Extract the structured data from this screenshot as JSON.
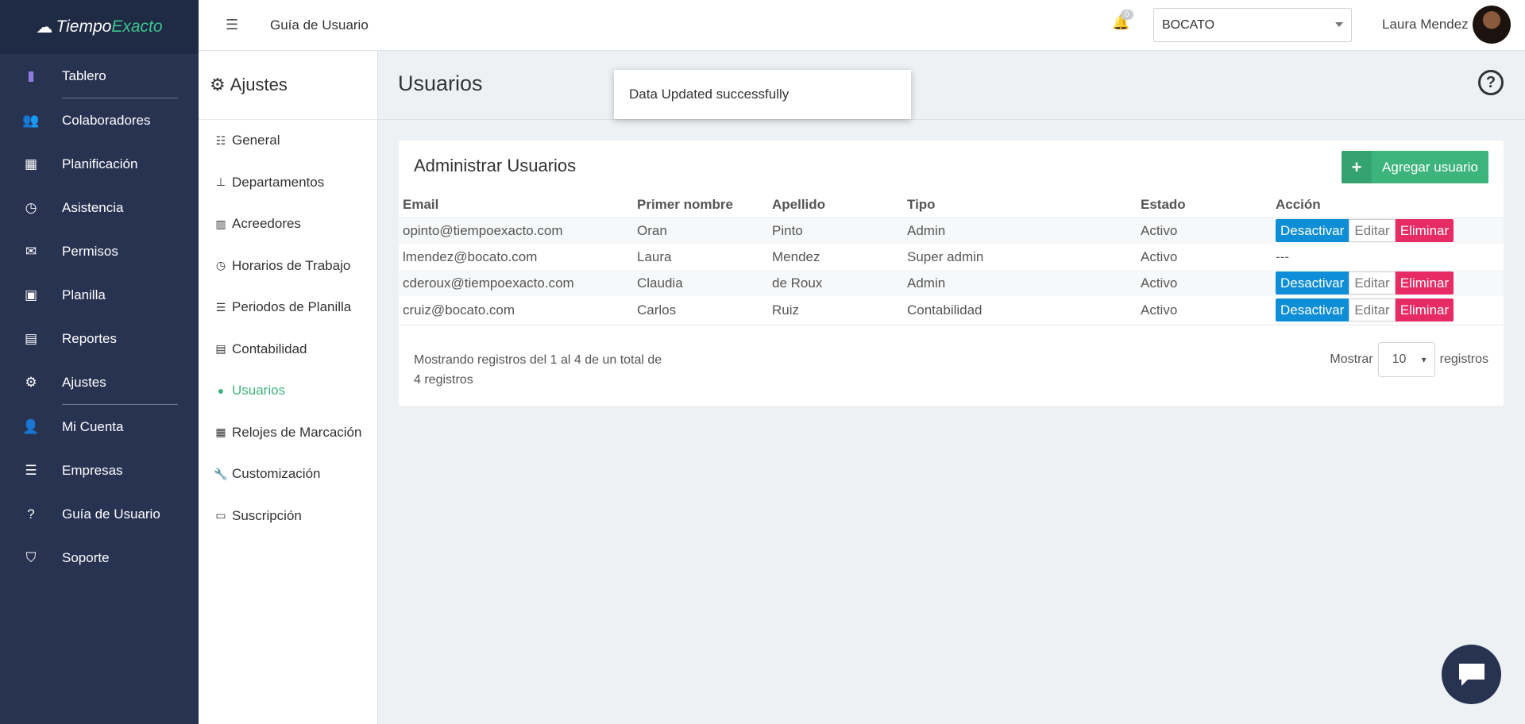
{
  "brand": {
    "part1": "Tiempo",
    "part2": "Exacto"
  },
  "leftnav": {
    "items": [
      {
        "label": "Tablero",
        "icon": "bar-chart-icon"
      },
      {
        "label": "Colaboradores",
        "icon": "users-icon"
      },
      {
        "label": "Planificación",
        "icon": "calendar-icon"
      },
      {
        "label": "Asistencia",
        "icon": "clock-icon"
      },
      {
        "label": "Permisos",
        "icon": "inbox-icon"
      },
      {
        "label": "Planilla",
        "icon": "money-icon"
      },
      {
        "label": "Reportes",
        "icon": "file-icon"
      },
      {
        "label": "Ajustes",
        "icon": "gear-icon"
      },
      {
        "label": "Mi Cuenta",
        "icon": "user-icon"
      },
      {
        "label": "Empresas",
        "icon": "sliders-icon"
      },
      {
        "label": "Guía de Usuario",
        "icon": "question-icon"
      },
      {
        "label": "Soporte",
        "icon": "shield-icon"
      }
    ]
  },
  "topbar": {
    "title": "Guía de Usuario",
    "notifications_count": "0",
    "company": "BOCATO",
    "username": "Laura Mendez"
  },
  "subnav": {
    "title": "Ajustes",
    "items": [
      {
        "label": "General",
        "icon": "list-icon"
      },
      {
        "label": "Departamentos",
        "icon": "sitemap-icon"
      },
      {
        "label": "Acreedores",
        "icon": "building-icon"
      },
      {
        "label": "Horarios de Trabajo",
        "icon": "clock-icon"
      },
      {
        "label": "Periodos de Planilla",
        "icon": "calendar-list-icon"
      },
      {
        "label": "Contabilidad",
        "icon": "ledger-icon"
      },
      {
        "label": "Usuarios",
        "icon": "user-icon"
      },
      {
        "label": "Relojes de Marcación",
        "icon": "fax-icon"
      },
      {
        "label": "Customización",
        "icon": "wrench-icon"
      },
      {
        "label": "Suscripción",
        "icon": "credit-card-icon"
      }
    ],
    "active": "Usuarios"
  },
  "page": {
    "title": "Usuarios"
  },
  "toast": {
    "message": "Data Updated successfully"
  },
  "card": {
    "title": "Administrar Usuarios",
    "add_label": "Agregar usuario",
    "columns": [
      "Email",
      "Primer nombre",
      "Apellido",
      "Tipo",
      "Estado",
      "Acción"
    ],
    "rows": [
      {
        "email": "opinto@tiempoexacto.com",
        "first": "Oran",
        "last": "Pinto",
        "type": "Admin",
        "status": "Activo",
        "actions": true
      },
      {
        "email": "lmendez@bocato.com",
        "first": "Laura",
        "last": "Mendez",
        "type": "Super admin",
        "status": "Activo",
        "actions": false,
        "no_action": "---"
      },
      {
        "email": "cderoux@tiempoexacto.com",
        "first": "Claudia",
        "last": "de Roux",
        "type": "Admin",
        "status": "Activo",
        "actions": true
      },
      {
        "email": "cruiz@bocato.com",
        "first": "Carlos",
        "last": "Ruiz",
        "type": "Contabilidad",
        "status": "Activo",
        "actions": true
      }
    ],
    "action_labels": {
      "deactivate": "Desactivar",
      "edit": "Editar",
      "delete": "Eliminar"
    },
    "footer_info": "Mostrando registros del 1 al 4 de un total de 4 registros",
    "pager": {
      "show": "Mostrar",
      "per_page": "10",
      "records": "registros"
    }
  },
  "colors": {
    "sidebar": "#283352",
    "accent_green": "#3cb47b",
    "blue": "#0f8ed8",
    "pink": "#e72b64"
  }
}
